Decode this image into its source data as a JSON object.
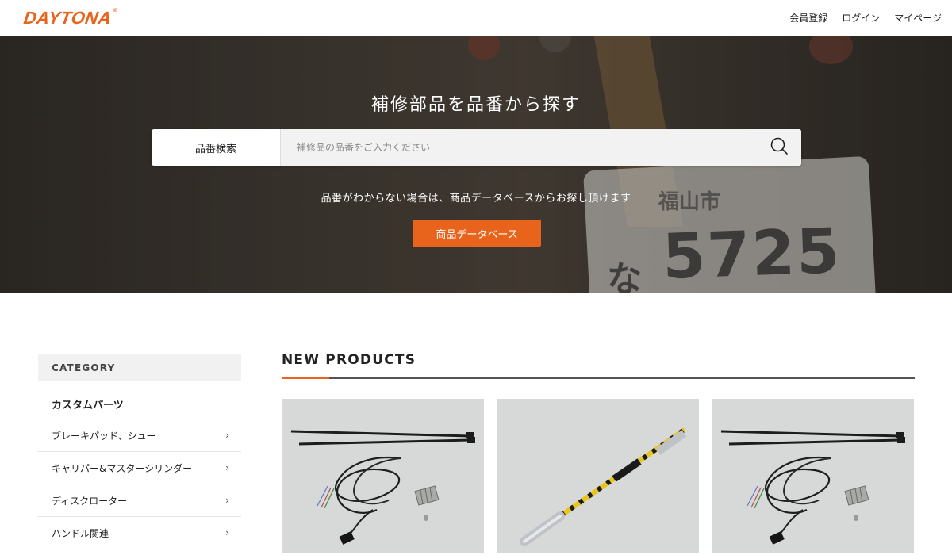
{
  "brand": {
    "logo_text": "DAYTONA",
    "accent_color": "#e8641c"
  },
  "top_nav": [
    {
      "label": "会員登録"
    },
    {
      "label": "ログイン"
    },
    {
      "label": "マイページ"
    }
  ],
  "hero": {
    "title": "補修部品を品番から探す",
    "search": {
      "label": "品番検索",
      "placeholder": "補修品の品番をご入力ください",
      "value": "",
      "button_icon": "search-icon"
    },
    "subtitle": "品番がわからない場合は、商品データベースからお探し頂けます",
    "button_label": "商品データベース",
    "background_plate": {
      "number": "5725",
      "kana": "な"
    }
  },
  "sidebar": {
    "heading": "CATEGORY",
    "group_title": "カスタムパーツ",
    "items": [
      {
        "label": "ブレーキパッド、シュー",
        "icon": "chevron-right-icon"
      },
      {
        "label": "キャリパー&マスターシリンダー",
        "icon": "chevron-right-icon"
      },
      {
        "label": "ディスクローター",
        "icon": "chevron-right-icon"
      },
      {
        "label": "ハンドル関連",
        "icon": "chevron-right-icon"
      }
    ]
  },
  "products": {
    "heading": "NEW PRODUCTS",
    "items": [
      {
        "image": "wiring-harness-with-cable-ties"
      },
      {
        "image": "yellow-sensor-rod"
      },
      {
        "image": "wiring-harness-with-cable-ties"
      }
    ]
  }
}
